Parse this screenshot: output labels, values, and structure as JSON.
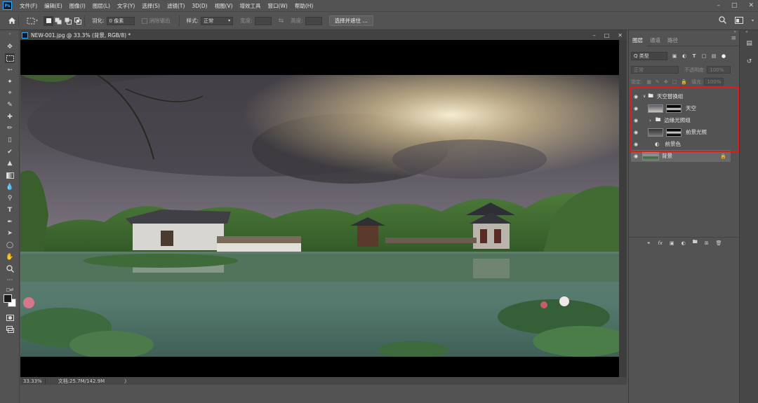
{
  "menubar": {
    "items": [
      "文件(F)",
      "编辑(E)",
      "图像(I)",
      "图层(L)",
      "文字(Y)",
      "选择(S)",
      "滤镜(T)",
      "3D(D)",
      "视图(V)",
      "增效工具",
      "窗口(W)",
      "帮助(H)"
    ],
    "min_icon": "minimize-icon",
    "max_icon": "maximize-icon",
    "close_icon": "close-icon"
  },
  "options": {
    "feather_label": "羽化:",
    "feather_value": "0 像素",
    "antialias_label": "消除锯齿",
    "style_label": "样式:",
    "style_value": "正常",
    "width_label": "宽度:",
    "height_label": "高度:",
    "select_mask_button": "选择并遮住 ..."
  },
  "document": {
    "tab_title": "NEW-001.jpg @ 33.3% (背景, RGB/8) *",
    "zoom": "33.33%",
    "doc_size": "文档:25.7M/142.9M",
    "arrow": "〉"
  },
  "panel": {
    "tabs": [
      "图层",
      "通道",
      "路径"
    ],
    "filter_kind": "Q 类型",
    "blend_mode": "正常",
    "opacity_label": "不透明度:",
    "opacity_value": "100%",
    "lock_label": "锁定:",
    "fill_label": "填充:",
    "fill_value": "100%",
    "layers": [
      {
        "name": "天空替换组",
        "type": "group",
        "open": true
      },
      {
        "name": "天空",
        "type": "image-mask"
      },
      {
        "name": "边缘光照组",
        "type": "group",
        "open": false
      },
      {
        "name": "前景光照",
        "type": "image-mask"
      },
      {
        "name": "前景色",
        "type": "adjustment"
      },
      {
        "name": "背景",
        "type": "background",
        "selected": true
      }
    ]
  },
  "colors": {
    "accent": "#31a8ff",
    "highlight": "#e11a1a",
    "ui_bg": "#535353"
  }
}
